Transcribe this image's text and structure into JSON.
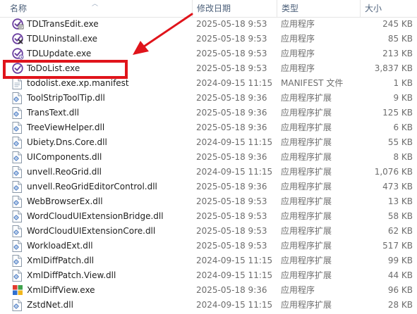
{
  "columns": {
    "name": "名称",
    "date": "修改日期",
    "type": "类型",
    "size": "大小"
  },
  "files": [
    {
      "name": "TDLTransEdit.exe",
      "date": "2025-05-18 9:53",
      "type": "应用程序",
      "size": "245 KB",
      "icon": "tdl-transedit-icon"
    },
    {
      "name": "TDLUninstall.exe",
      "date": "2025-05-18 9:53",
      "type": "应用程序",
      "size": "85 KB",
      "icon": "tdl-uninstall-icon"
    },
    {
      "name": "TDLUpdate.exe",
      "date": "2025-05-18 9:53",
      "type": "应用程序",
      "size": "213 KB",
      "icon": "tdl-update-icon"
    },
    {
      "name": "ToDoList.exe",
      "date": "2025-05-18 9:53",
      "type": "应用程序",
      "size": "3,837 KB",
      "icon": "todolist-icon"
    },
    {
      "name": "todolist.exe.xp.manifest",
      "date": "2024-09-15 11:15",
      "type": "MANIFEST 文件",
      "size": "1 KB",
      "icon": "manifest-file-icon"
    },
    {
      "name": "ToolStripToolTip.dll",
      "date": "2025-05-18 9:36",
      "type": "应用程序扩展",
      "size": "9 KB",
      "icon": "dll-file-icon"
    },
    {
      "name": "TransText.dll",
      "date": "2025-05-18 9:36",
      "type": "应用程序扩展",
      "size": "125 KB",
      "icon": "dll-file-icon"
    },
    {
      "name": "TreeViewHelper.dll",
      "date": "2025-05-18 9:36",
      "type": "应用程序扩展",
      "size": "6 KB",
      "icon": "dll-file-icon"
    },
    {
      "name": "Ubiety.Dns.Core.dll",
      "date": "2024-09-15 11:15",
      "type": "应用程序扩展",
      "size": "55 KB",
      "icon": "dll-file-icon"
    },
    {
      "name": "UIComponents.dll",
      "date": "2025-05-18 9:36",
      "type": "应用程序扩展",
      "size": "8 KB",
      "icon": "dll-file-icon"
    },
    {
      "name": "unvell.ReoGrid.dll",
      "date": "2024-09-15 11:15",
      "type": "应用程序扩展",
      "size": "1,076 KB",
      "icon": "dll-file-icon"
    },
    {
      "name": "unvell.ReoGridEditorControl.dll",
      "date": "2025-05-18 9:36",
      "type": "应用程序扩展",
      "size": "473 KB",
      "icon": "dll-file-icon"
    },
    {
      "name": "WebBrowserEx.dll",
      "date": "2025-05-18 9:53",
      "type": "应用程序扩展",
      "size": "13 KB",
      "icon": "dll-file-icon"
    },
    {
      "name": "WordCloudUIExtensionBridge.dll",
      "date": "2025-05-18 9:53",
      "type": "应用程序扩展",
      "size": "58 KB",
      "icon": "dll-file-icon"
    },
    {
      "name": "WordCloudUIExtensionCore.dll",
      "date": "2025-05-18 9:53",
      "type": "应用程序扩展",
      "size": "62 KB",
      "icon": "dll-file-icon"
    },
    {
      "name": "WorkloadExt.dll",
      "date": "2025-05-18 9:53",
      "type": "应用程序扩展",
      "size": "517 KB",
      "icon": "dll-file-icon"
    },
    {
      "name": "XmlDiffPatch.dll",
      "date": "2024-09-15 11:15",
      "type": "应用程序扩展",
      "size": "99 KB",
      "icon": "dll-file-icon"
    },
    {
      "name": "XmlDiffPatch.View.dll",
      "date": "2024-09-15 11:15",
      "type": "应用程序扩展",
      "size": "44 KB",
      "icon": "dll-file-icon"
    },
    {
      "name": "XmlDiffView.exe",
      "date": "2025-05-18 9:36",
      "type": "应用程序",
      "size": "96 KB",
      "icon": "xmldiffview-icon"
    },
    {
      "name": "ZstdNet.dll",
      "date": "2024-09-15 11:15",
      "type": "应用程序扩展",
      "size": "28 KB",
      "icon": "dll-file-icon"
    }
  ],
  "colors": {
    "highlight_box": "#e0141b",
    "arrow": "#e0141b",
    "header_text": "#4c607a",
    "secondary_text": "#6d6d6d"
  }
}
